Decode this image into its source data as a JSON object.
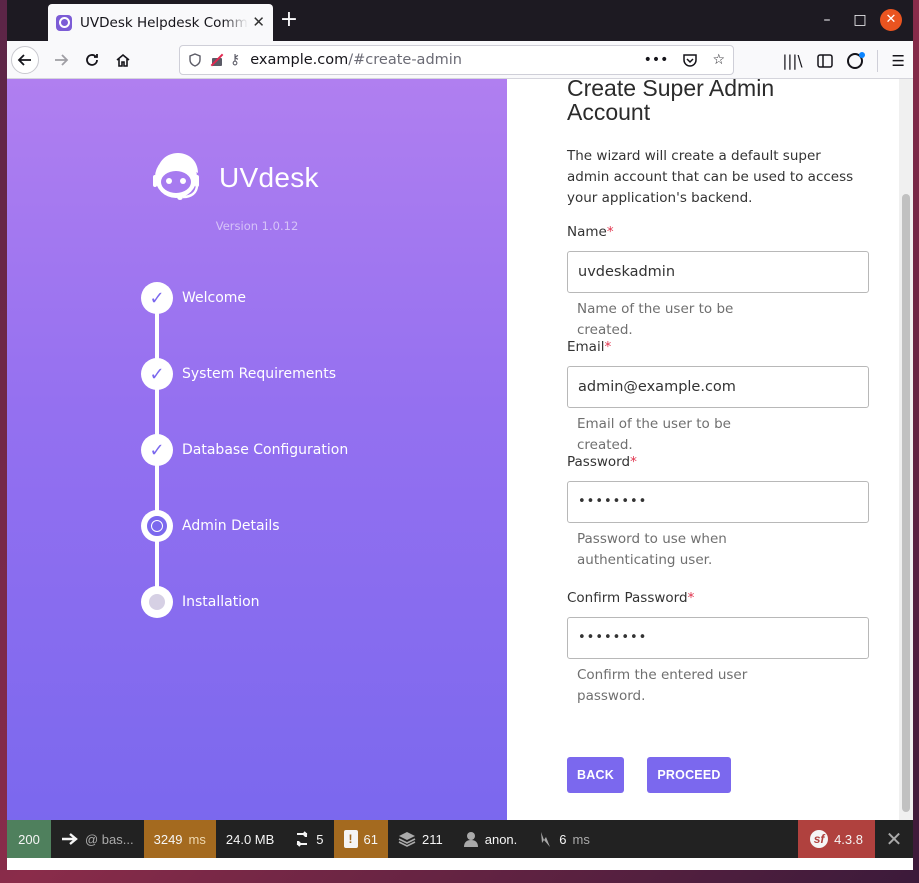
{
  "browser": {
    "tab_title": "UVDesk Helpdesk Comm",
    "tab_close": "✕",
    "new_tab": "+",
    "url_host": "example.com",
    "url_path": "/#create-admin",
    "url_more": "•••"
  },
  "sidebar": {
    "logo_text": "UVdesk",
    "version": "Version 1.0.12",
    "steps": [
      {
        "label": "Welcome",
        "state": "done"
      },
      {
        "label": "System Requirements",
        "state": "done"
      },
      {
        "label": "Database Configuration",
        "state": "done"
      },
      {
        "label": "Admin Details",
        "state": "active"
      },
      {
        "label": "Installation",
        "state": "pending"
      }
    ]
  },
  "form": {
    "title": "Create Super Admin Account",
    "description": "The wizard will create a default super admin account that can be used to access your application's backend.",
    "required_mark": "*",
    "fields": [
      {
        "label": "Name",
        "value": "uvdeskadmin",
        "help": "Name of the user to be created."
      },
      {
        "label": "Email",
        "value": "admin@example.com",
        "help": "Email of the user to be created."
      },
      {
        "label": "Password",
        "value": "••••••••",
        "help": "Password to use when authenticating user."
      },
      {
        "label": "Confirm Password",
        "value": "••••••••",
        "help": "Confirm the entered user password."
      }
    ],
    "back_label": "BACK",
    "proceed_label": "PROCEED"
  },
  "debug_toolbar": {
    "status_code": "200",
    "route": "@ bas...",
    "time_value": "3249",
    "time_unit": "ms",
    "memory": "24.0 MB",
    "requests": "5",
    "warnings": "61",
    "layers": "211",
    "user": "anon.",
    "db_time_value": "6",
    "db_time_unit": "ms",
    "symfony_version": "4.3.8",
    "colors": {
      "status": "#4f805d",
      "warning": "#a46a1f",
      "symfony": "#b0413e"
    }
  },
  "colors": {
    "accent": "#7b68ee",
    "required": "#e0314b"
  }
}
